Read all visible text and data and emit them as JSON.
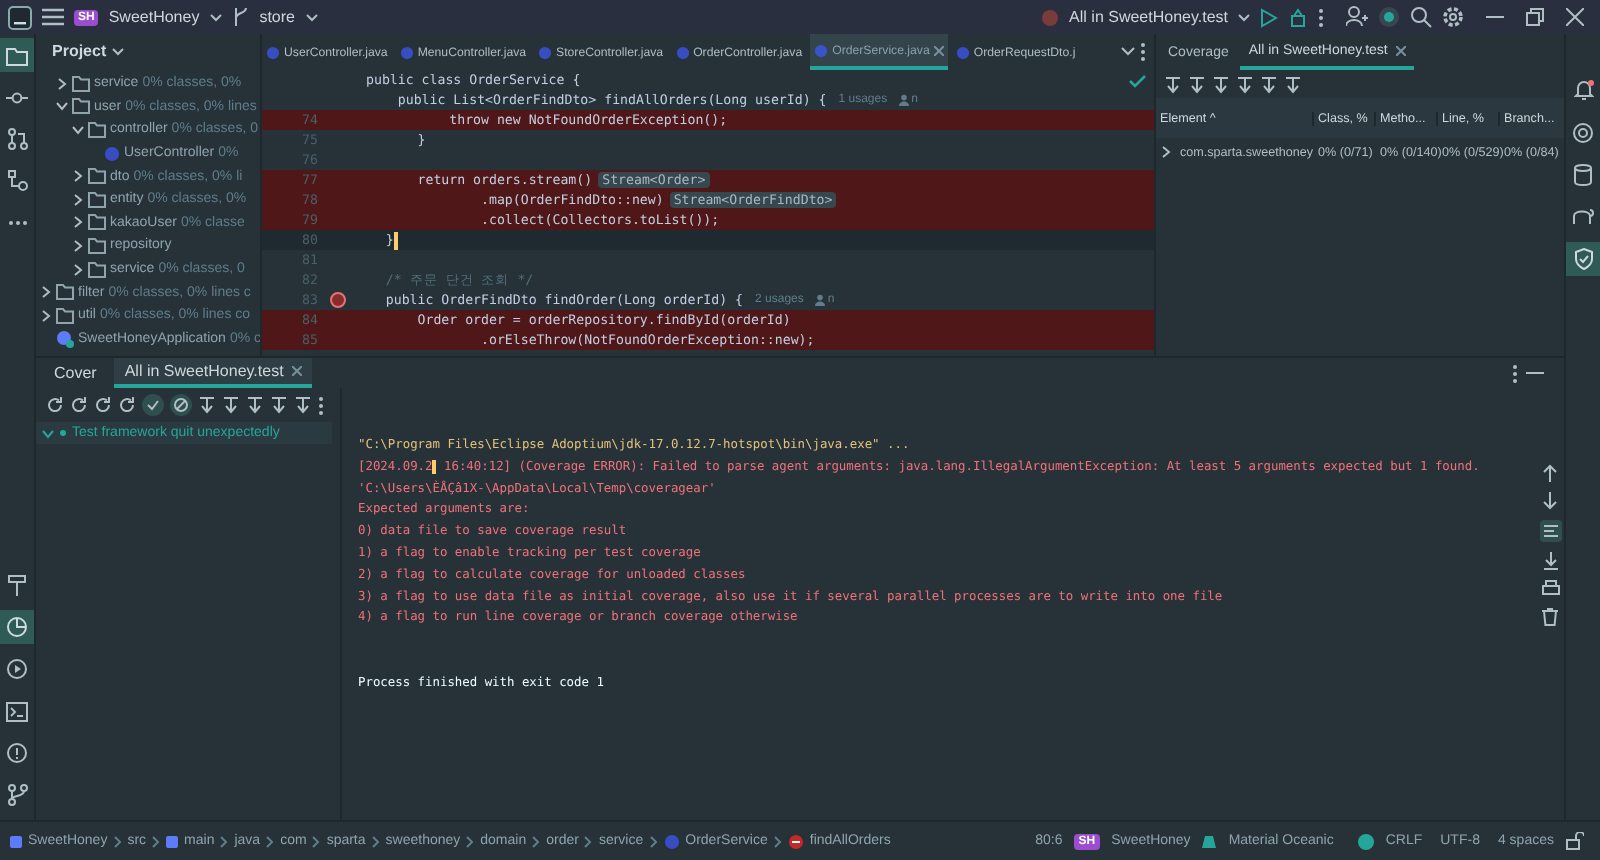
{
  "title_bar": {
    "badge": "SH",
    "project": "SweetHoney",
    "branch": "store",
    "run_config": "All in SweetHoney.test"
  },
  "project_panel": {
    "title": "Project",
    "tree": [
      {
        "children": [
          {
            "kind": "folder",
            "name": "service",
            "stat": "0% classes, 0%",
            "expanded": false
          },
          {
            "kind": "folder",
            "name": "user",
            "stat": "0% classes, 0% lines",
            "expanded": true,
            "children": [
              {
                "kind": "folder",
                "name": "controller",
                "stat": "0% classes, 0",
                "expanded": true,
                "children": [
                  {
                    "kind": "class",
                    "name": "UserController",
                    "stat": "0%"
                  }
                ]
              },
              {
                "kind": "folder",
                "name": "dto",
                "stat": "0% classes, 0% li",
                "expanded": false
              },
              {
                "kind": "folder",
                "name": "entity",
                "stat": "0% classes, 0%",
                "expanded": false
              },
              {
                "kind": "folder",
                "name": "kakaoUser",
                "stat": "0% classe",
                "expanded": false
              },
              {
                "kind": "folder",
                "name": "repository",
                "expanded": false
              },
              {
                "kind": "folder",
                "name": "service",
                "stat": "0% classes, 0",
                "expanded": false
              }
            ]
          }
        ]
      },
      {
        "kind": "folder",
        "name": "filter",
        "stat": "0% classes, 0% lines c",
        "expanded": false
      },
      {
        "kind": "folder",
        "name": "util",
        "stat": "0% classes, 0% lines co",
        "expanded": false
      },
      {
        "kind": "app",
        "name": "SweetHoneyApplication",
        "stat": "0% c"
      }
    ]
  },
  "editor": {
    "tabs": [
      {
        "label": "UserController.java",
        "selected": false
      },
      {
        "label": "MenuController.java",
        "selected": false
      },
      {
        "label": "StoreController.java",
        "selected": false
      },
      {
        "label": "OrderController.java",
        "selected": false
      },
      {
        "label": "OrderService.java",
        "selected": true
      },
      {
        "label": "OrderRequestDto.j",
        "selected": false
      }
    ],
    "sticky": [
      {
        "code": "public class OrderService {"
      },
      {
        "code": "    public List<OrderFindDto> findAllOrders(Long userId) {",
        "usages": "1 usages",
        "author": "n"
      }
    ],
    "lines": [
      {
        "number": "74",
        "code": "            throw new NotFoundOrderException();",
        "uncovered": true
      },
      {
        "number": "75",
        "code": "        }",
        "uncovered": false
      },
      {
        "number": "76",
        "uncovered": false
      },
      {
        "number": "77",
        "code": "        return orders.stream()",
        "hint": "Stream<Order>",
        "uncovered": true
      },
      {
        "number": "78",
        "code": "                .map(OrderFindDto::new)",
        "hint": "Stream<OrderFindDto>",
        "uncovered": true
      },
      {
        "number": "79",
        "code": "                .collect(Collectors.toList());",
        "uncovered": true
      },
      {
        "number": "80",
        "code": "    }",
        "uncovered": false,
        "current": true
      },
      {
        "number": "81",
        "uncovered": false
      },
      {
        "number": "82",
        "code": "    /* 주문 단건 조회 */",
        "kind": "comment",
        "uncovered": false
      },
      {
        "number": "83",
        "code": "    public OrderFindDto findOrder(Long orderId) {",
        "usages": "2 usages",
        "author": "n",
        "gutter_mark": true,
        "uncovered": false
      },
      {
        "number": "84",
        "code": "        Order order = orderRepository.findById(orderId)",
        "uncovered": true
      },
      {
        "number": "85",
        "code": "                .orElseThrow(NotFoundOrderException::new);",
        "uncovered": true
      }
    ]
  },
  "coverage_panel": {
    "tabs": [
      {
        "label": "Coverage",
        "selected": false
      },
      {
        "label": "All in SweetHoney.test",
        "selected": true
      }
    ],
    "columns": [
      "Element ^",
      "Class, %",
      "Metho...",
      "Line, %",
      "Branch..."
    ],
    "rows": [
      {
        "cells": [
          "com.sparta.sweethoney",
          "0% (0/71)",
          "0% (0/140)",
          "0% (0/529)",
          "0% (0/84)"
        ],
        "expanded": false
      }
    ]
  },
  "bottom_panel": {
    "tabs": [
      {
        "label": "Cover",
        "selected": false
      },
      {
        "label": "All in SweetHoney.test",
        "selected": true
      }
    ],
    "test_tree": [
      {
        "label": "Test framework quit unexpectedly",
        "expanded": true
      }
    ],
    "console": [
      {
        "kind": "command",
        "text": "\"C:\\Program Files\\Eclipse Adoptium\\jdk-17.0.12.7-hotspot\\bin\\java.exe\" ..."
      },
      {
        "kind": "error",
        "text": "[2024.09.2",
        "text_after": " 16:40:12] (Coverage ERROR): Failed to parse agent arguments: java.lang.IllegalArgumentException: At least 5 arguments expected but 1 found."
      },
      {
        "kind": "error",
        "text": "'C:\\Users\\ÈÅÇâ1X-\\AppData\\Local\\Temp\\coveragear'"
      },
      {
        "kind": "error",
        "text": "Expected arguments are:"
      },
      {
        "kind": "error",
        "text": "0) data file to save coverage result"
      },
      {
        "kind": "error",
        "text": "1) a flag to enable tracking per test coverage"
      },
      {
        "kind": "error",
        "text": "2) a flag to calculate coverage for unloaded classes"
      },
      {
        "kind": "error",
        "text": "3) a flag to use data file as initial coverage, also use it if several parallel processes are to write into one file"
      },
      {
        "kind": "error",
        "text": "4) a flag to run line coverage or branch coverage otherwise"
      },
      {
        "kind": "blank"
      },
      {
        "kind": "blank"
      },
      {
        "kind": "plain",
        "text": "Process finished with exit code 1"
      }
    ]
  },
  "status_bar": {
    "breadcrumbs": [
      {
        "label": "SweetHoney",
        "kind": "module"
      },
      {
        "label": "src"
      },
      {
        "label": "main",
        "kind": "module"
      },
      {
        "label": "java"
      },
      {
        "label": "com"
      },
      {
        "label": "sparta"
      },
      {
        "label": "sweethoney"
      },
      {
        "label": "domain"
      },
      {
        "label": "order"
      },
      {
        "label": "service"
      },
      {
        "label": "OrderService",
        "kind": "class"
      },
      {
        "label": "findAllOrders",
        "kind": "method"
      }
    ],
    "position": "80:6",
    "badge": "SH",
    "project": "SweetHoney",
    "theme": "Material Oceanic",
    "line_separator": "CRLF",
    "encoding": "UTF-8",
    "indent": "4 spaces"
  }
}
